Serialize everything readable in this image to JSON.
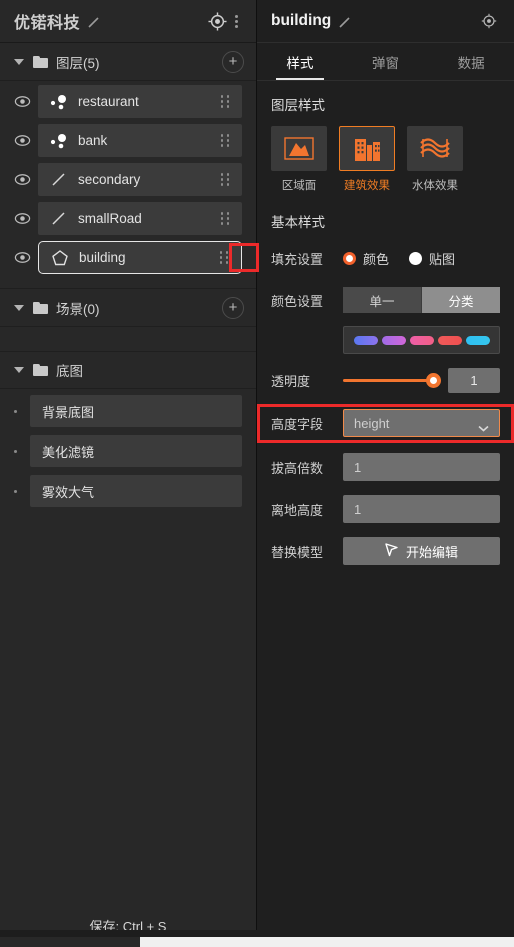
{
  "left_panel": {
    "title": "优锘科技",
    "header_icons": {
      "locate": "target-icon",
      "menu": "more-vertical-icon"
    },
    "layers_group": {
      "label": "图层(5)",
      "add_label": "+"
    },
    "layers": [
      {
        "name": "restaurant",
        "geom": "point",
        "visible": true,
        "selected": false
      },
      {
        "name": "bank",
        "geom": "point",
        "visible": true,
        "selected": false
      },
      {
        "name": "secondary",
        "geom": "line",
        "visible": true,
        "selected": false
      },
      {
        "name": "smallRoad",
        "geom": "line",
        "visible": true,
        "selected": false
      },
      {
        "name": "building",
        "geom": "polygon",
        "visible": true,
        "selected": true
      }
    ],
    "scene_group": {
      "label": "场景(0)",
      "add_label": "+"
    },
    "basemap_group": {
      "label": "底图"
    },
    "basemap_items": [
      {
        "name": "背景底图"
      },
      {
        "name": "美化滤镜"
      },
      {
        "name": "雾效大气"
      }
    ],
    "footer": "保存: Ctrl + S"
  },
  "right_panel": {
    "title": "building",
    "locate_icon": "target-icon",
    "tabs": [
      {
        "label": "样式",
        "active": true
      },
      {
        "label": "弹窗",
        "active": false
      },
      {
        "label": "数据",
        "active": false
      }
    ],
    "layer_style": {
      "section_title": "图层样式",
      "tiles": [
        {
          "label": "区域面",
          "icon": "area-polygon-icon",
          "active": false
        },
        {
          "label": "建筑效果",
          "icon": "building-icon",
          "active": true
        },
        {
          "label": "水体效果",
          "icon": "water-wave-icon",
          "active": false
        }
      ]
    },
    "basic_style": {
      "section_title": "基本样式",
      "fill_label": "填充设置",
      "fill_options": [
        {
          "label": "颜色",
          "selected": true
        },
        {
          "label": "贴图",
          "selected": false
        }
      ],
      "color_label": "颜色设置",
      "color_modes": [
        {
          "label": "单一",
          "active": false
        },
        {
          "label": "分类",
          "active": true
        }
      ],
      "swatches": [
        "#6b7bef",
        "#b06ae6",
        "#ef5fa0",
        "#f05454",
        "#35bff0"
      ],
      "opacity_label": "透明度",
      "opacity_value": "1",
      "opacity_percent": 100,
      "height_field_label": "高度字段",
      "height_field_value": "height",
      "height_scale_label": "拔高倍数",
      "height_scale_value": "1",
      "ground_height_label": "离地高度",
      "ground_height_value": "1",
      "replace_model_label": "替换模型",
      "replace_model_button": "开始编辑"
    }
  },
  "colors": {
    "accent": "#f2752f",
    "highlight": "#ec2a2a",
    "panel_left": "#282828",
    "panel_right": "#1f1f1f"
  }
}
